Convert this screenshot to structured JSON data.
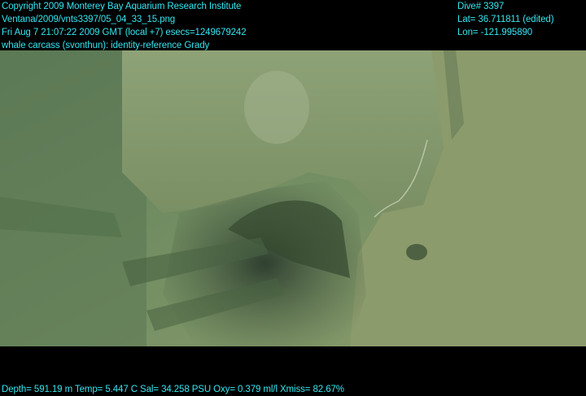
{
  "overlay": {
    "line1": "Copyright 2009 Monterey Bay Aquarium Research Institute",
    "line2": "Ventana/2009/vnts3397/05_04_33_15.png",
    "line3": "Fri Aug  7 21:07:22 2009 GMT (local +7)  esecs=1249679242",
    "line4": "whale carcass (svonthun): identity-reference Grady",
    "dive": "Dive# 3397",
    "lat": "Lat= 36.711811 (edited)",
    "lon": "Lon= -121.995890",
    "telemetry": "Depth= 591.19 m  Temp= 5.447 C  Sal= 34.258 PSU  Oxy= 0.379 ml/l  Xmiss= 82.67%"
  },
  "colors": {
    "overlay_text": "#35e6f0",
    "water": "#6f8c62",
    "sediment": "#8a9a6a",
    "shadow": "#3c5035"
  }
}
